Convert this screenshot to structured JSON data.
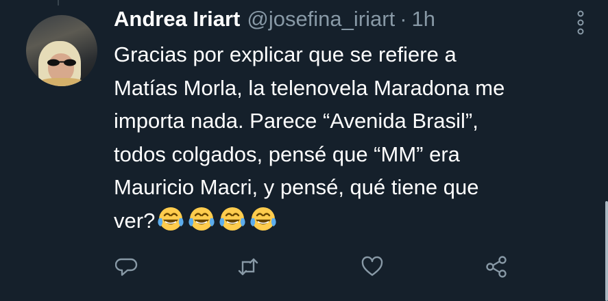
{
  "tweet": {
    "author_name": "Andrea Iriart",
    "handle": "@josefina_iriart",
    "separator": "·",
    "timestamp": "1h",
    "text_lines": [
      "Gracias por explicar que se refiere a",
      "Matías Morla, la telenovela Maradona me",
      "importa nada. Parece “Avenida Brasil”,",
      "todos colgados, pensé que “MM” era",
      "Mauricio Macri, y pensé, qué tiene que",
      "ver?"
    ],
    "emojis": [
      "😂",
      "😂",
      "😂",
      "😂"
    ]
  },
  "icons": {
    "more": "more-vertical-icon",
    "reply": "reply-icon",
    "retweet": "retweet-icon",
    "like": "heart-icon",
    "share": "share-icon"
  },
  "colors": {
    "background": "#15202b",
    "text": "#ffffff",
    "secondary": "#8899a6",
    "emoji_face": "#ffcc4d"
  }
}
